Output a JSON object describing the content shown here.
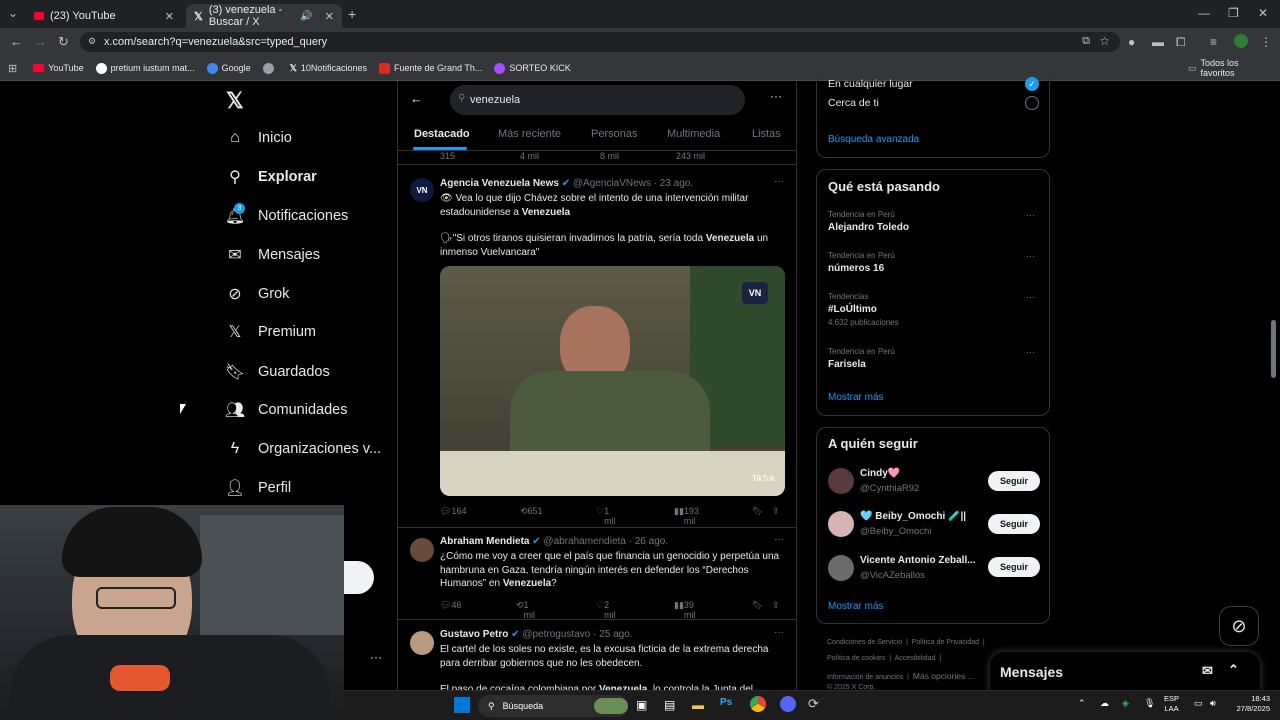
{
  "browser": {
    "tabs": [
      {
        "title": "(23) YouTube",
        "active": false
      },
      {
        "title": "(3) venezuela - Buscar / X",
        "active": true
      }
    ],
    "url": "x.com/search?q=venezuela&src=typed_query",
    "bookmarks": [
      "YouTube",
      "pretium iustum mat...",
      "Google",
      "",
      "10Notificaciones",
      "Fuente de Grand Th...",
      "SORTEO KICK"
    ],
    "all_bookmarks": "Todos los favoritos"
  },
  "sidebar": {
    "items": [
      {
        "label": "Inicio",
        "icon": "home-icon"
      },
      {
        "label": "Explorar",
        "icon": "search-icon"
      },
      {
        "label": "Notificaciones",
        "icon": "bell-icon",
        "badge": "3"
      },
      {
        "label": "Mensajes",
        "icon": "mail-icon"
      },
      {
        "label": "Grok",
        "icon": "grok-icon"
      },
      {
        "label": "Premium",
        "icon": "x-logo-icon"
      },
      {
        "label": "Guardados",
        "icon": "bookmark-icon"
      },
      {
        "label": "Comunidades",
        "icon": "communities-icon"
      },
      {
        "label": "Organizaciones v...",
        "icon": "lightning-icon"
      },
      {
        "label": "Perfil",
        "icon": "profile-icon"
      }
    ]
  },
  "search": {
    "query": "venezuela"
  },
  "tabs": [
    "Destacado",
    "Más reciente",
    "Personas",
    "Multimedia",
    "Listas"
  ],
  "prev_post_stats": {
    "replies": "315",
    "reposts": "4 mil",
    "likes": "8 mil",
    "views": "243 mil"
  },
  "posts": [
    {
      "name": "Agencia Venezuela News",
      "handle": "@AgenciaVNews",
      "date": "23 ago.",
      "line1": "👁 Vea lo que dijo Chávez sobre el intento de una intervención militar estadounidense a ",
      "bold1": "Venezuela",
      "line2": "🗣\"Si otros tiranos quisieran invadirnos la patria, sería toda ",
      "bold2": "Venezuela",
      "line2b": " un inmenso Vuelvancara\"",
      "media_watermark": "TikTok",
      "replies": "164",
      "reposts": "651",
      "likes": "1 mil",
      "views": "193 mil"
    },
    {
      "name": "Abraham Mendieta",
      "handle": "@abrahamendieta",
      "date": "26 ago.",
      "text": "¿Cómo me voy a creer que el país que financia un genocidio y perpetúa una hambruna en Gaza, tendría ningún interés en defender los “Derechos Humanos” en ",
      "bold": "Venezuela",
      "tail": "?",
      "replies": "46",
      "reposts": "1 mil",
      "likes": "2 mil",
      "views": "39 mil"
    },
    {
      "name": "Gustavo Petro",
      "handle": "@petrogustavo",
      "date": "25 ago.",
      "text": "El cartel de los soles no existe, es la excusa ficticia de la extrema derecha para derribar gobiernos que no les obedecen.",
      "text2": "El paso de cocaína colombiana por ",
      "bold2": "Venezuela",
      "tail2": ", lo controla la Junta del"
    }
  ],
  "location": {
    "anywhere": "En cualquier lugar",
    "near": "Cerca de ti",
    "advanced": "Búsqueda avanzada"
  },
  "trends": {
    "title": "Qué está pasando",
    "items": [
      {
        "meta": "Tendencia en Perú",
        "name": "Alejandro Toledo",
        "count": ""
      },
      {
        "meta": "Tendencia en Perú",
        "name": "números 16",
        "count": ""
      },
      {
        "meta": "Tendencias",
        "name": "#LoÚltimo",
        "count": "4.632 publicaciones"
      },
      {
        "meta": "Tendencia en Perú",
        "name": "Farisela",
        "count": ""
      }
    ],
    "more": "Mostrar más"
  },
  "who_to_follow": {
    "title": "A quién seguir",
    "items": [
      {
        "name": "Cindy🩷",
        "handle": "@CynthiaR92",
        "button": "Seguir"
      },
      {
        "name": "🩵 Beiby_Omochi 🧪||",
        "handle": "@Beiby_Omochi",
        "button": "Seguir"
      },
      {
        "name": "Vicente Antonio Zeball...",
        "handle": "@VicAZeballos",
        "button": "Seguir"
      }
    ],
    "more": "Mostrar más"
  },
  "footer": {
    "links": [
      "Condiciones de Servicio",
      "Política de Privacidad",
      "Política de cookies",
      "Accesibilidad",
      "Información de anuncios",
      "Más opciones ..."
    ],
    "copyright": "© 2025 X Corp."
  },
  "messages": {
    "title": "Mensajes"
  },
  "taskbar": {
    "search": "Búsqueda",
    "lang1": "ESP",
    "lang2": "LAA",
    "time": "18:43",
    "date": "27/8/2025"
  },
  "colors": {
    "accent": "#1d9bf0",
    "bg": "#000000",
    "border": "#2f3336"
  }
}
